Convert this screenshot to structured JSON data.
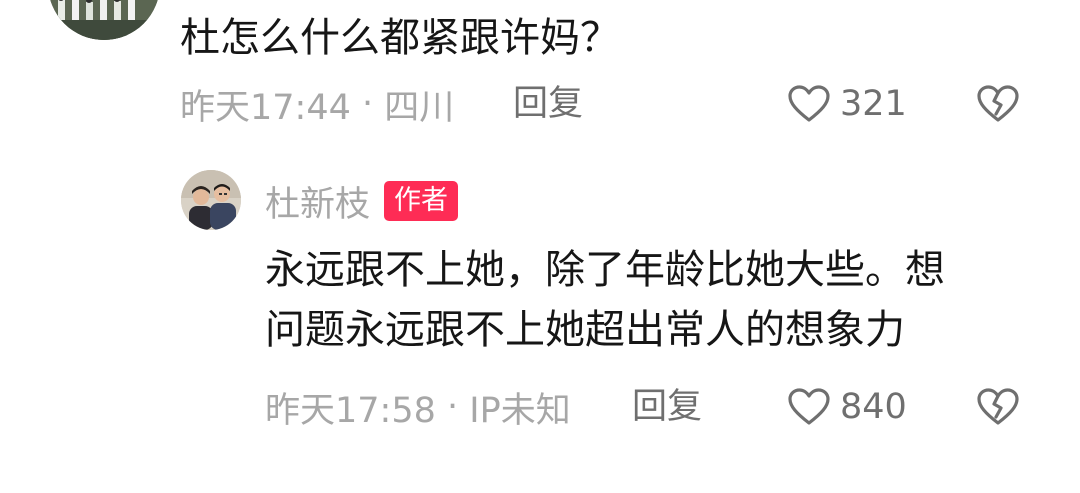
{
  "top_comment": {
    "text": "杜怎么什么都紧跟许妈？",
    "time": "昨天17:44",
    "separator": " · ",
    "location": "四川",
    "reply_label": "回复",
    "likes": "321"
  },
  "reply_comment": {
    "author": "杜新枝",
    "badge": "作者",
    "text_line1": "永远跟不上她，除了年龄比她大些。想",
    "text_line2": "问题永远跟不上她超出常人的想象力",
    "time": "昨天17:58",
    "separator": " · ",
    "location": "IP未知",
    "reply_label": "回复",
    "likes": "840"
  },
  "icons": {
    "like": "heart-outline-icon",
    "dislike": "broken-heart-icon"
  },
  "colors": {
    "badge": "#fe2c55",
    "meta_text": "#a7a7a7",
    "action_text": "#6f6f6f",
    "body_text": "#161616"
  }
}
